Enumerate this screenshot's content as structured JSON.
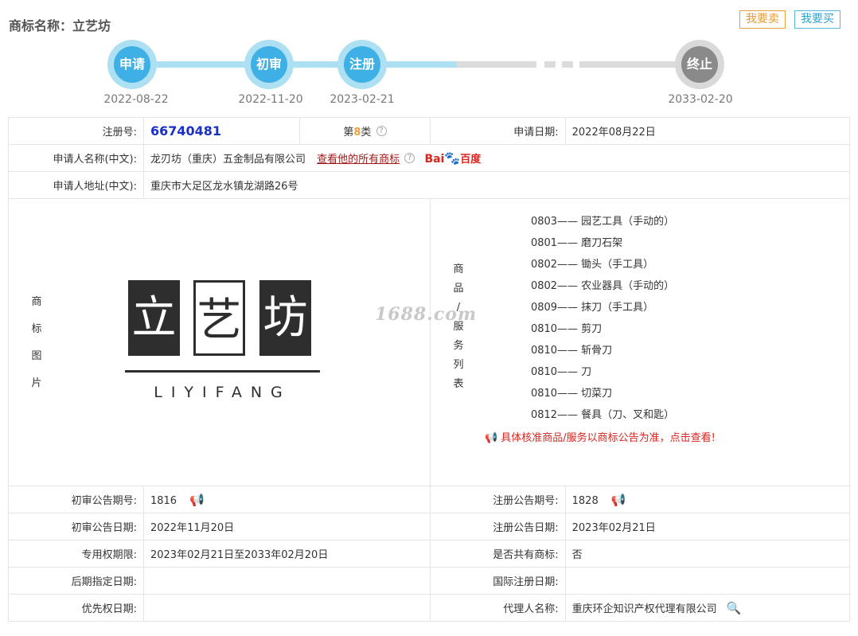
{
  "header": {
    "title": "商标名称：立艺坊",
    "sell_label": "我要卖",
    "buy_label": "我要买"
  },
  "timeline": [
    {
      "label": "申请",
      "date": "2022-08-22",
      "state": "done"
    },
    {
      "label": "初审",
      "date": "2022-11-20",
      "state": "done"
    },
    {
      "label": "注册",
      "date": "2023-02-21",
      "state": "done"
    },
    {
      "label": "终止",
      "date": "2033-02-20",
      "state": "pending"
    }
  ],
  "info": {
    "reg_no_label": "注册号:",
    "reg_no": "66740481",
    "class_prefix": "第",
    "class_num": "8",
    "class_suffix": "类",
    "apply_date_label": "申请日期:",
    "apply_date": "2022年08月22日",
    "applicant_label": "申请人名称(中文):",
    "applicant": "龙刃坊（重庆）五金制品有限公司",
    "all_marks_link": "查看他的所有商标",
    "baidu_label": "Bai",
    "baidu_cn": "百度",
    "address_label": "申请人地址(中文):",
    "address": "重庆市大足区龙水镇龙湖路26号",
    "image_label_chars": [
      "商",
      "标",
      "图",
      "片"
    ],
    "goods_label_chars": [
      "商",
      "品",
      "/",
      "服",
      "务",
      "列",
      "表"
    ],
    "logo": {
      "chars": [
        "立",
        "艺",
        "坊"
      ],
      "pinyin": "LIYIFANG"
    },
    "watermark": "1688.com",
    "goods": [
      "0803—— 园艺工具（手动的）",
      "0801—— 磨刀石架",
      "0802—— 锄头（手工具）",
      "0802—— 农业器具（手动的）",
      "0809—— 抹刀（手工具）",
      "0810—— 剪刀",
      "0810—— 斩骨刀",
      "0810—— 刀",
      "0810—— 切菜刀",
      "0812—— 餐具（刀、叉和匙）"
    ],
    "goods_note": "具体核准商品/服务以商标公告为准，点击查看!",
    "prelim_issue_label": "初审公告期号:",
    "prelim_issue": "1816",
    "reg_issue_label": "注册公告期号:",
    "reg_issue": "1828",
    "prelim_date_label": "初审公告日期:",
    "prelim_date": "2022年11月20日",
    "reg_date_label": "注册公告日期:",
    "reg_date": "2023年02月21日",
    "exclusive_label": "专用权期限:",
    "exclusive": "2023年02月21日至2033年02月20日",
    "shared_label": "是否共有商标:",
    "shared": "否",
    "later_label": "后期指定日期:",
    "later": "",
    "intl_label": "国际注册日期:",
    "intl": "",
    "priority_label": "优先权日期:",
    "priority": "",
    "agent_label": "代理人名称:",
    "agent": "重庆环企知识产权代理有限公司"
  }
}
